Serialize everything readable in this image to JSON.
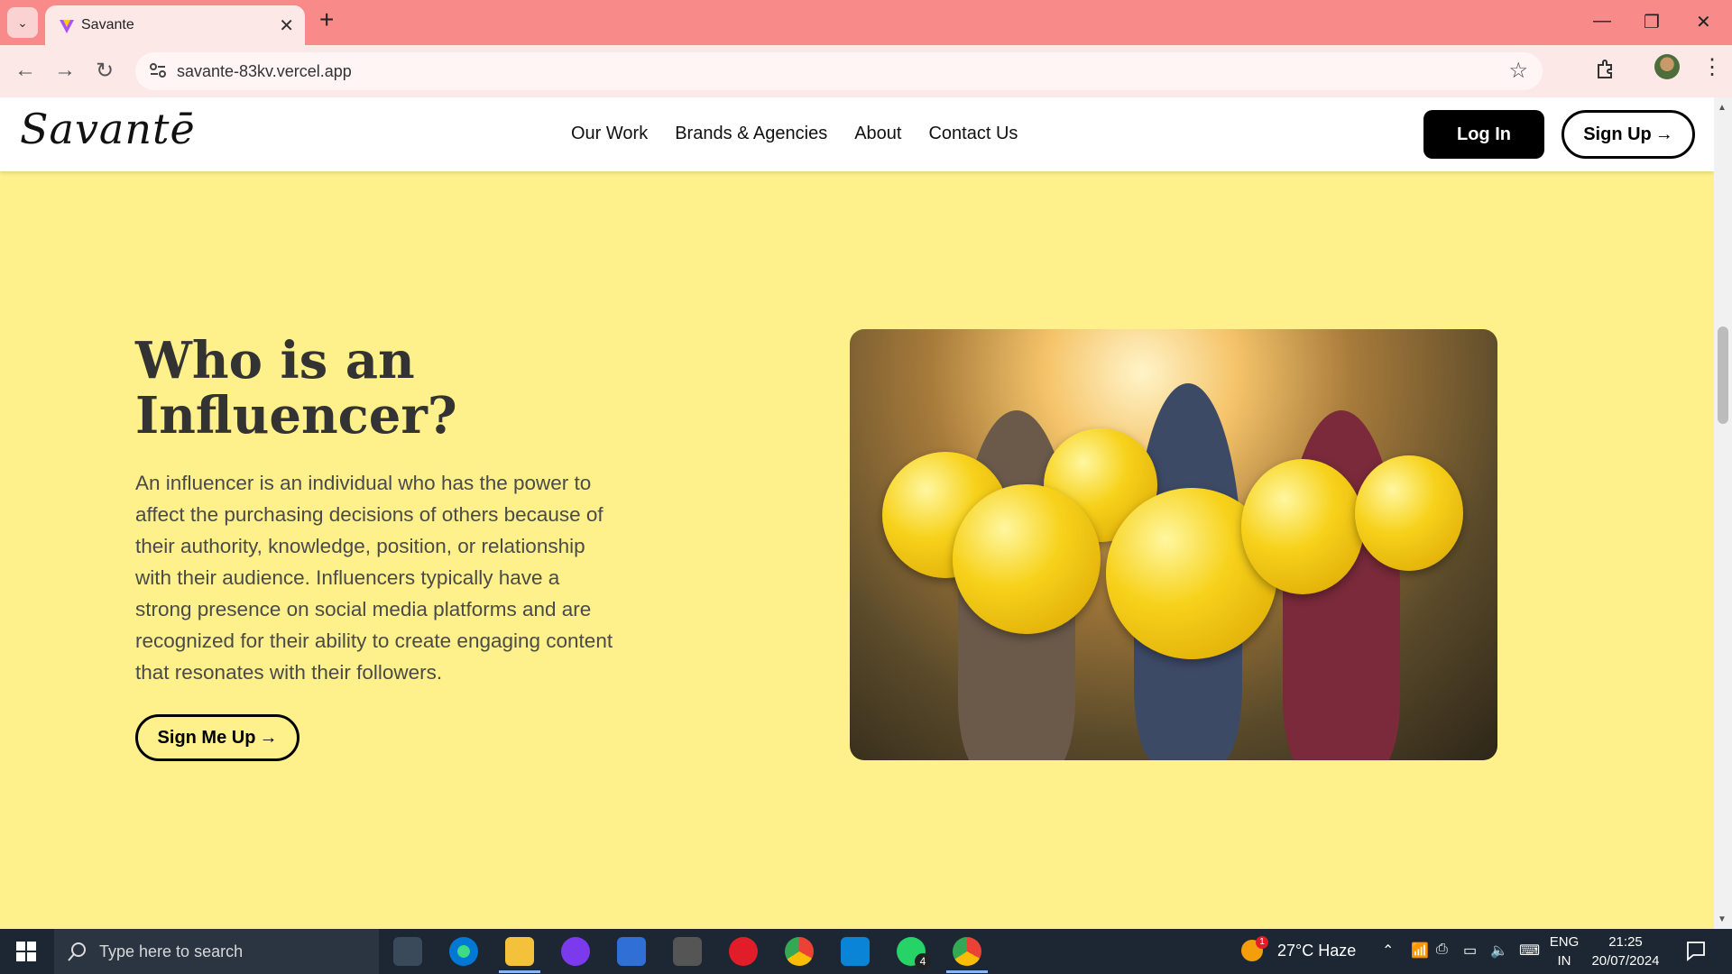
{
  "browser": {
    "tab_title": "Savante",
    "url": "savante-83kv.vercel.app",
    "weather": "27°C  Haze"
  },
  "site": {
    "logo": "Savantē",
    "nav": [
      "Our Work",
      "Brands & Agencies",
      "About",
      "Contact Us"
    ],
    "login_label": "Log In",
    "signup_label": "Sign Up",
    "colors": {
      "section_bg": "#fef08a",
      "text_dark": "#333333",
      "button_black": "#000000"
    }
  },
  "hero": {
    "headline_line1": "Who is an",
    "headline_line2": "Influencer?",
    "body": "An influencer is an individual who has the power to affect the purchasing decisions of others because of their authority, knowledge, position, or relationship with their audience. Influencers typically have a strong presence on social media platforms and are recognized for their ability to create engaging content that resonates with their followers.",
    "cta_label": "Sign Me Up"
  },
  "taskbar": {
    "search_placeholder": "Type here to search",
    "whatsapp_badge": "4",
    "weather_badge": "1",
    "lang_line1": "ENG",
    "lang_line2": "IN",
    "time": "21:25",
    "date": "20/07/2024"
  }
}
